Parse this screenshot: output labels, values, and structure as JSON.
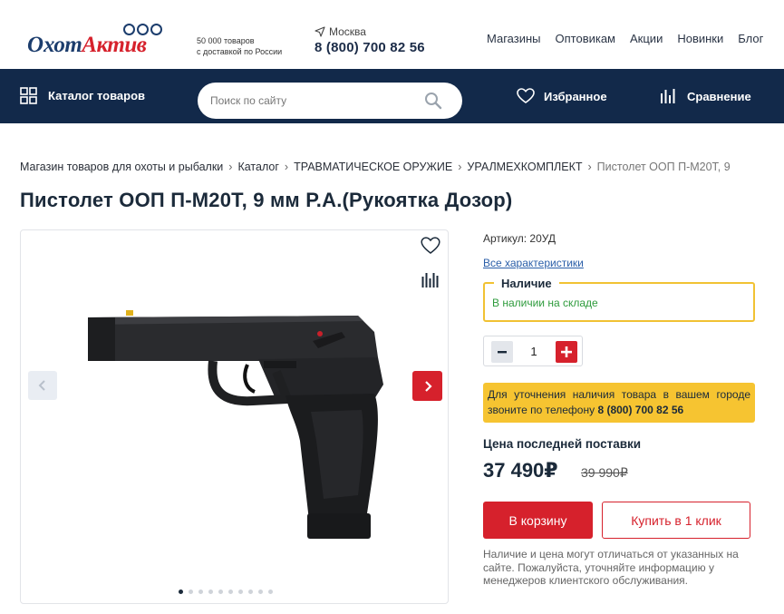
{
  "header": {
    "logo": {
      "part1": "Охот",
      "part2": "Актив"
    },
    "tagline_line1": "50 000 товаров",
    "tagline_line2": "с доставкой по России",
    "city": "Москва",
    "phone": "8 (800) 700 82 56",
    "nav": [
      "Магазины",
      "Оптовикам",
      "Акции",
      "Новинки",
      "Блог"
    ]
  },
  "navbar": {
    "catalog_label": "Каталог товаров",
    "search_placeholder": "Поиск по сайту",
    "favorites_label": "Избранное",
    "compare_label": "Сравнение"
  },
  "breadcrumb": [
    "Магазин товаров для охоты и рыбалки",
    "Каталог",
    "ТРАВМАТИЧЕСКОЕ ОРУЖИЕ",
    "УРАЛМЕХКОМПЛЕКТ",
    "Пистолет ООП П-М20Т, 9"
  ],
  "product": {
    "title": "Пистолет ООП П-М20Т, 9 мм Р.А.(Рукоятка Дозор)",
    "sku": "Артикул: 20УД",
    "all_specs": "Все характеристики",
    "availability_title": "Наличие",
    "availability_text": "В наличии на складе",
    "quantity": "1",
    "phone_note_text": "Для уточнения наличия товара в вашем городе звоните по телефону",
    "phone_note_number": "8 (800) 700 82 56",
    "price_label": "Цена последней поставки",
    "price": "37 490₽",
    "old_price": "39 990₽",
    "cart_button": "В корзину",
    "one_click_button": "Купить в 1 клик",
    "disclaimer": "Наличие и цена могут отличаться от указанных на сайте. Пожалуйста, уточняйте информацию у менеджеров клиентского обслуживания."
  },
  "gallery": {
    "slide_count": 10,
    "active_slide": 1
  },
  "colors": {
    "navy": "#12294a",
    "brand_red": "#d6212c",
    "highlight_yellow": "#f6c431",
    "stock_green": "#2e9b3c",
    "link_blue": "#2a5ea8"
  }
}
